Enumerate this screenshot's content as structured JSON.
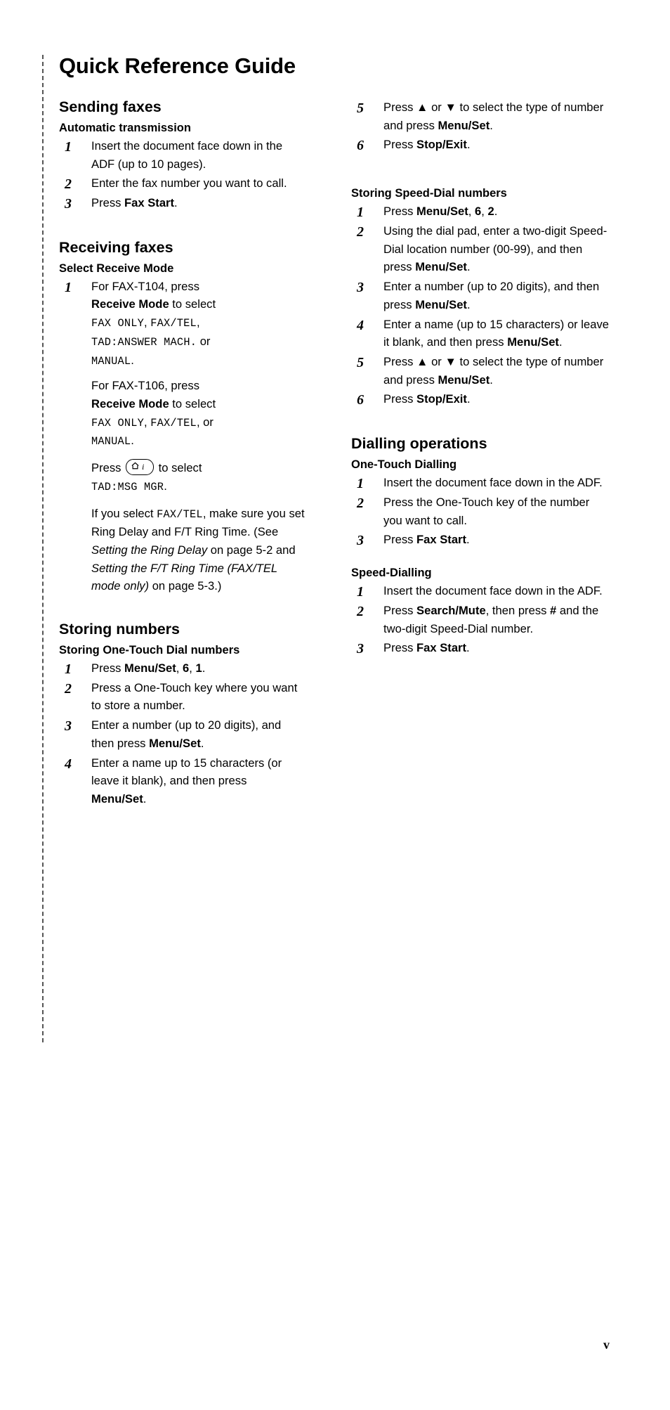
{
  "document": {
    "title": "Quick Reference Guide",
    "page_number": "v"
  },
  "left_column": {
    "sections": [
      {
        "heading": "Sending faxes",
        "subheading": "Automatic transmission",
        "steps": [
          "Insert the document face down in the ADF (up to 10 pages).",
          "Enter the fax number you want to call.",
          "Press Fax Start."
        ]
      },
      {
        "heading": "Receiving faxes",
        "subheading": "Select Receive Mode",
        "step1_line1": "For FAX-T104, press",
        "step1_line2_bold": "Receive Mode",
        "step1_line2_rest": " to select",
        "step1_modes_a": "FAX ONLY",
        "step1_modes_b": "FAX/TEL",
        "step1_modes_c": "TAD:ANSWER MACH.",
        "step1_or": " or ",
        "step1_modes_d": "MANUAL",
        "step1b_line1": "For FAX-T106, press",
        "step1b_line2_bold": "Receive Mode",
        "step1b_line2_rest": " to select",
        "step1b_modes_a": "FAX ONLY",
        "step1b_modes_b": "FAX/TEL",
        "step1b_or": ", or ",
        "step1b_modes_c": "MANUAL",
        "press_label": "Press",
        "press_icon_label": "message-manager-icon",
        "press_rest": "to select",
        "press_mode": "TAD:MSG MGR",
        "note_a": "If you select ",
        "note_mode": "FAX/TEL",
        "note_b": ", make sure you set Ring Delay and F/T Ring Time. (See ",
        "note_italic1": "Setting the Ring Delay",
        "note_c": " on page 5-2 and ",
        "note_italic2": "Setting the F/T Ring Time (FAX/TEL mode only)",
        "note_d": " on page 5-3.)"
      },
      {
        "heading": "Storing numbers",
        "subheading": "Storing One-Touch Dial numbers",
        "step1_a": "Press ",
        "step1_bold": "Menu/Set",
        "step1_b": ", ",
        "step1_n1": "6",
        "step1_c": ", ",
        "step1_n2": "1",
        "step1_d": ".",
        "step2": "Press a One-Touch key where you want to store a number.",
        "step3_a": "Enter a number (up to 20 digits), and then press ",
        "step3_bold": "Menu/Set",
        "step3_b": ".",
        "step4_a": "Enter a name up to 15 characters (or leave it blank), and then press ",
        "step4_bold": "Menu/Set",
        "step4_b": "."
      }
    ]
  },
  "right_column": {
    "continued_steps": {
      "step5_a": "Press ",
      "step5_up": "▲",
      "step5_mid": " or ",
      "step5_down": "▼",
      "step5_b": " to select the type of number and press ",
      "step5_bold": "Menu/Set",
      "step5_c": ".",
      "step6_a": "Press ",
      "step6_bold": "Stop/Exit",
      "step6_b": "."
    },
    "sections": [
      {
        "subheading": "Storing Speed-Dial numbers",
        "step1_a": "Press ",
        "step1_bold": "Menu/Set",
        "step1_b": ", ",
        "step1_n1": "6",
        "step1_c": ", ",
        "step1_n2": "2",
        "step1_d": ".",
        "step2_a": "Using the dial pad, enter a two-digit Speed-Dial location number (00-99), and then press ",
        "step2_bold": "Menu/Set",
        "step2_b": ".",
        "step3_a": "Enter a number (up to 20 digits), and then press ",
        "step3_bold": "Menu/Set",
        "step3_b": ".",
        "step4_a": "Enter a name (up to 15 characters) or leave it blank, and then press ",
        "step4_bold": "Menu/Set",
        "step4_b": ".",
        "step5_a": "Press ",
        "step5_up": "▲",
        "step5_mid": " or ",
        "step5_down": "▼",
        "step5_b": " to select the type of number and press ",
        "step5_bold": "Menu/Set",
        "step5_c": ".",
        "step6_a": "Press ",
        "step6_bold": "Stop/Exit",
        "step6_b": "."
      },
      {
        "heading": "Dialling operations",
        "subheading": "One-Touch Dialling",
        "step1": "Insert the document face down in the ADF.",
        "step2": "Press the One-Touch key of the number you want to call.",
        "step3_a": "Press ",
        "step3_bold": "Fax Start",
        "step3_b": "."
      },
      {
        "subheading": "Speed-Dialling",
        "step1": "Insert the document face down in the ADF.",
        "step2_a": "Press ",
        "step2_bold": "Search/Mute",
        "step2_b": ", then press ",
        "step2_bold2": "#",
        "step2_c": " and the two-digit Speed-Dial number.",
        "step3_a": "Press ",
        "step3_bold": "Fax Start",
        "step3_b": "."
      }
    ]
  },
  "step_numbers": {
    "n1": "1",
    "n2": "2",
    "n3": "3",
    "n4": "4",
    "n5": "5",
    "n6": "6"
  },
  "fax_start_label": "Fax Start"
}
